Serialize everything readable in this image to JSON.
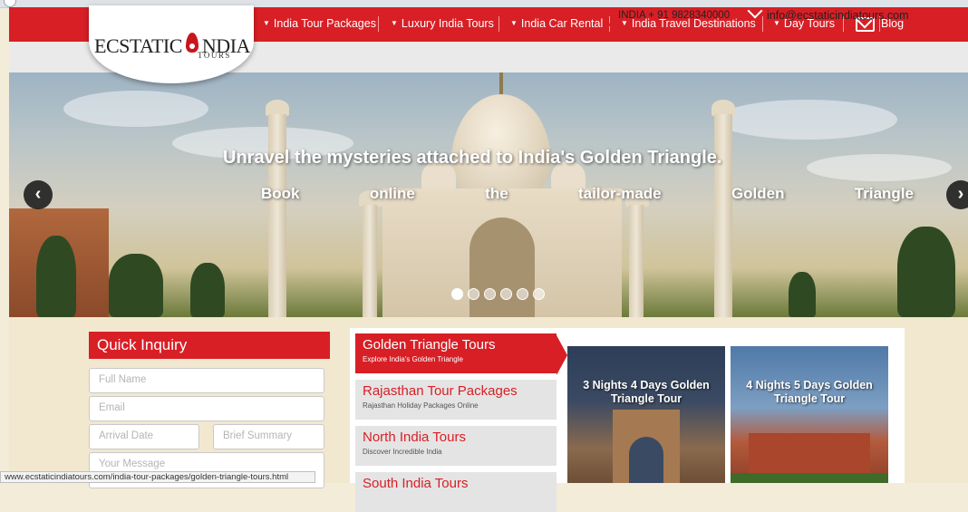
{
  "nav": {
    "items": [
      {
        "label": "India Tour Packages",
        "dropdown": true
      },
      {
        "label": "Luxury India Tours",
        "dropdown": true
      },
      {
        "label": "India Car Rental",
        "dropdown": true
      },
      {
        "label": "India Travel Destinations",
        "dropdown": true
      },
      {
        "label": "Day Tours",
        "dropdown": true
      }
    ],
    "blog_label": "Blog",
    "mail_icon": "envelope-outline-icon",
    "color": "#d81f26"
  },
  "logo": {
    "word_a": "ECSTATIC",
    "word_b": "NDIA",
    "sub": "TOURS"
  },
  "contact": {
    "phone": "INDIA + 91 9828340000",
    "email": "info@ecstaticindiatours.com",
    "phone_icon": "phone-icon",
    "email_icon": "envelope-icon"
  },
  "hero": {
    "heading": "Unravel the mysteries attached to India's Golden Triangle.",
    "sub": "Book online the tailor-made Golden Triangle",
    "prev_icon": "chevron-left-icon",
    "next_icon": "chevron-right-icon",
    "slide_count": 6,
    "active_slide": 1
  },
  "inquiry": {
    "title": "Quick Inquiry",
    "full_name_placeholder": "Full Name",
    "email_placeholder": "Email",
    "arrival_placeholder": "Arrival Date",
    "summary_placeholder": "Brief Summary",
    "message_placeholder": "Your Message"
  },
  "tours": {
    "tabs": [
      {
        "title": "Golden Triangle Tours",
        "sub": "Explore India's Golden Triangle",
        "active": true
      },
      {
        "title": "Rajasthan Tour Packages",
        "sub": "Rajasthan Holiday Packages Online",
        "active": false
      },
      {
        "title": "North India Tours",
        "sub": "Discover Incredible India",
        "active": false
      },
      {
        "title": "South India Tours",
        "sub": "",
        "active": false
      }
    ],
    "cards": [
      {
        "title": "3 Nights 4 Days Golden Triangle Tour"
      },
      {
        "title": "4 Nights 5 Days Golden Triangle Tour"
      }
    ]
  },
  "status_bar": {
    "url": "www.ecstaticindiatours.com/india-tour-packages/golden-triangle-tours.html"
  }
}
